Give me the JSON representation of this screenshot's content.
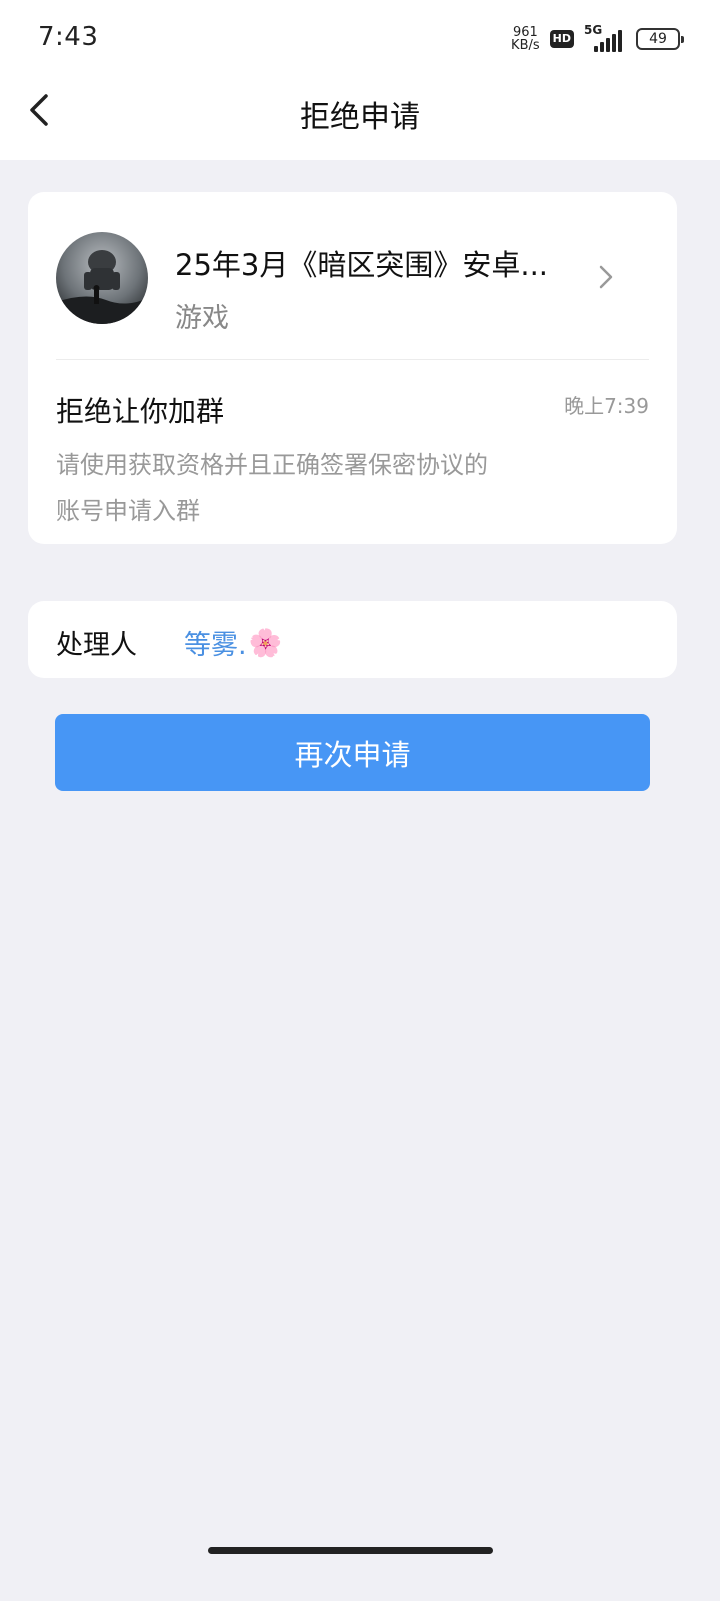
{
  "status_bar": {
    "time": "7:43",
    "net_speed_value": "961",
    "net_speed_unit": "KB/s",
    "hd_label": "HD",
    "network": "5G",
    "battery": "49"
  },
  "header": {
    "title": "拒绝申请",
    "back_icon": "chevron-left-icon"
  },
  "group": {
    "name": "25年3月《暗区突围》安卓...",
    "type": "游戏",
    "avatar": "game-character-avatar"
  },
  "rejection": {
    "title": "拒绝让你加群",
    "time": "晚上7:39",
    "reason_line1": "请使用获取资格并且正确签署保密协议的",
    "reason_line2": "账号申请入群"
  },
  "handler": {
    "label": "处理人",
    "name": "等雾.",
    "emoji": "🌸"
  },
  "actions": {
    "reapply_label": "再次申请"
  },
  "colors": {
    "accent": "#4796f5",
    "link": "#4a90e2",
    "background": "#f0f0f5"
  }
}
